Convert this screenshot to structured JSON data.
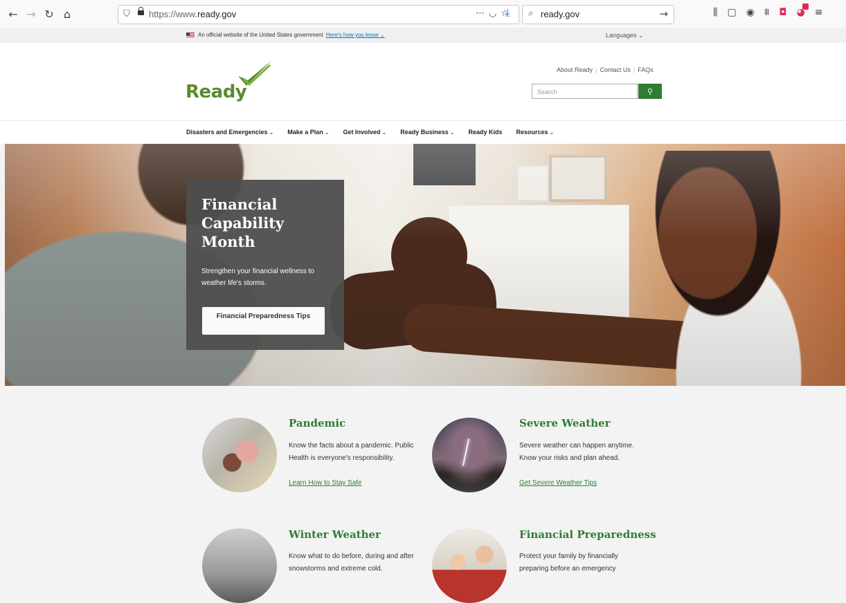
{
  "browser": {
    "url_prefix": "https://www.",
    "url_domain": "ready.gov",
    "search_query": "ready.gov",
    "icons": [
      "back-icon",
      "forward-icon",
      "reload-icon",
      "home-icon",
      "shield-icon",
      "lock-icon",
      "more-icon",
      "pocket-icon",
      "bookmark-star-icon",
      "download-icon",
      "search-icon",
      "go-arrow-icon",
      "library-icon",
      "sidebar-icon",
      "account-icon",
      "extension-icon",
      "screenshot-icon",
      "addon-icon",
      "menu-icon"
    ]
  },
  "gov_banner": {
    "text": "An official website of the United States government",
    "link": "Here's how you know ⌄",
    "languages": "Languages  ⌄"
  },
  "header": {
    "logo_text": "Ready",
    "util_links": [
      "About Ready",
      "Contact Us",
      "FAQs"
    ],
    "search_placeholder": "Search"
  },
  "nav": {
    "items": [
      {
        "label": "Disasters and Emergencies",
        "dropdown": true
      },
      {
        "label": "Make a Plan",
        "dropdown": true
      },
      {
        "label": "Get Involved",
        "dropdown": true
      },
      {
        "label": "Ready Business",
        "dropdown": true
      },
      {
        "label": "Ready Kids",
        "dropdown": false
      },
      {
        "label": "Resources",
        "dropdown": true
      }
    ]
  },
  "hero": {
    "title": "Financial Capability Month",
    "text": "Strengthen your financial wellness to weather life's storms.",
    "cta": "Financial Preparedness Tips"
  },
  "cards": [
    {
      "title": "Pandemic",
      "text": "Know the facts about a pandemic. Public Health is everyone's responsibility.",
      "link": "Learn How to Stay Safe"
    },
    {
      "title": "Severe Weather",
      "text": "Severe weather can happen anytime. Know your risks and plan ahead.",
      "link": "Get Severe Weather Tips"
    },
    {
      "title": "Winter Weather",
      "text": "Know what to do before, during and after snowstorms and extreme cold.",
      "link": ""
    },
    {
      "title": "Financial Preparedness",
      "text": "Protect your family by financially preparing before an emergency",
      "link": ""
    }
  ],
  "colors": {
    "brand_green": "#2e7d32",
    "logo_green": "#5a8a2e",
    "promo_bg": "#4e4e4e"
  }
}
